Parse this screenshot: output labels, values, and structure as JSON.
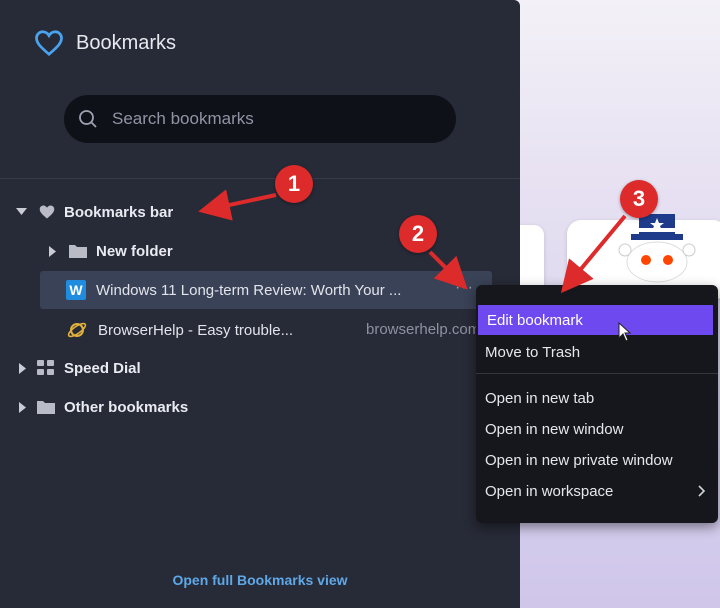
{
  "header": {
    "title": "Bookmarks"
  },
  "search": {
    "placeholder": "Search bookmarks"
  },
  "tree": {
    "bookmarks_bar": "Bookmarks bar",
    "new_folder": "New folder",
    "item_windows": "Windows 11 Long-term Review: Worth Your ...",
    "item_windows_icon": "W",
    "item_browserhelp": "BrowserHelp - Easy trouble...",
    "item_browserhelp_domain": "browserhelp.com",
    "speed_dial": "Speed Dial",
    "other_bookmarks": "Other bookmarks"
  },
  "footer": {
    "open_full": "Open full Bookmarks view"
  },
  "context_menu": {
    "edit": "Edit bookmark",
    "trash": "Move to Trash",
    "new_tab": "Open in new tab",
    "new_window": "Open in new window",
    "private_window": "Open in new private window",
    "workspace": "Open in workspace"
  },
  "annotations": {
    "one": "1",
    "two": "2",
    "three": "3"
  },
  "colors": {
    "panel": "#272a37",
    "accent": "#6e49f0",
    "badge": "#dd2a2a",
    "link": "#5fa8e8",
    "heart": "#4aa3ef"
  }
}
